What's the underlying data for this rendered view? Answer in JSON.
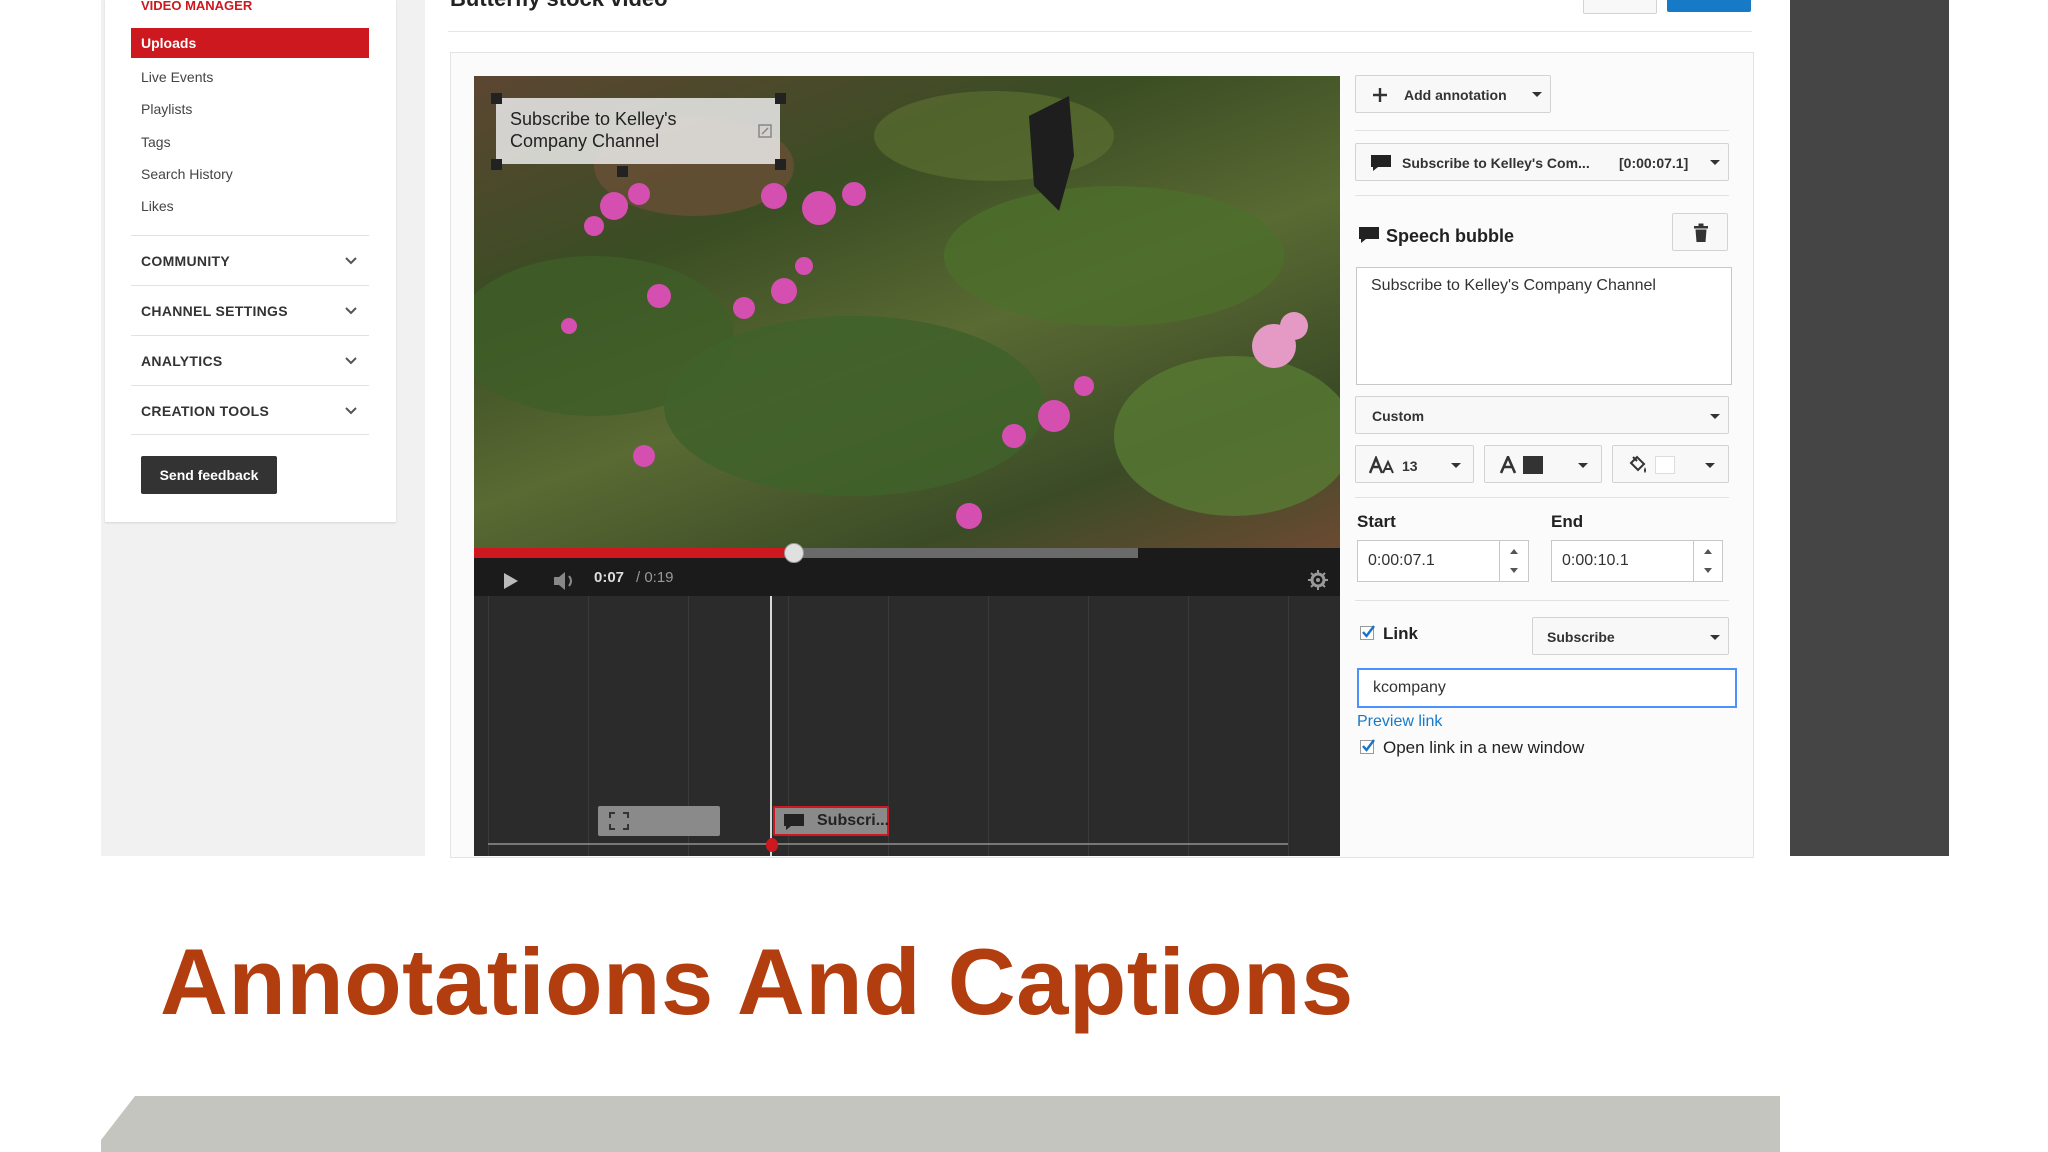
{
  "slide": {
    "title": "Annotations And Captions"
  },
  "page": {
    "video_title": "Butterfly stock video"
  },
  "sidebar": {
    "header": "VIDEO MANAGER",
    "active_item": "Uploads",
    "sub_items": [
      "Live Events",
      "Playlists",
      "Tags",
      "Search History",
      "Likes"
    ],
    "sections": [
      "COMMUNITY",
      "CHANNEL SETTINGS",
      "ANALYTICS",
      "CREATION TOOLS"
    ],
    "feedback_label": "Send feedback"
  },
  "video": {
    "annotation_text": "Subscribe to Kelley's Company Channel",
    "time_current": "0:07",
    "time_total": "/ 0:19",
    "progress": 0.37,
    "timeline_clip_label": "Subscri..."
  },
  "panel": {
    "add_annotation_label": "Add annotation",
    "selected_annotation": "Subscribe to Kelley's Com...",
    "selected_annotation_time": "[0:00:07.1]",
    "annotation_type": "Speech bubble",
    "annotation_text": "Subscribe to Kelley's Company Channel",
    "style": "Custom",
    "font_size": "13",
    "start_label": "Start",
    "start_value": "0:00:07.1",
    "end_label": "End",
    "end_value": "0:00:10.1",
    "link_label": "Link",
    "link_checked": true,
    "link_type": "Subscribe",
    "link_value": "kcompany",
    "preview_link_label": "Preview link",
    "open_new_window_label": "Open link in a new window",
    "open_new_window_checked": true
  },
  "colors": {
    "accent_red": "#cc181e",
    "title_orange": "#b23d0e",
    "link_blue": "#167ac6",
    "dark_panel": "#454545"
  },
  "icons": [
    "plus-icon",
    "speech-bubble-icon",
    "trash-icon",
    "chevron-down-icon",
    "play-icon",
    "volume-icon",
    "gear-icon",
    "font-size-icon",
    "font-color-icon",
    "paint-bucket-icon",
    "checkmark-icon",
    "fullscreen-icon"
  ]
}
